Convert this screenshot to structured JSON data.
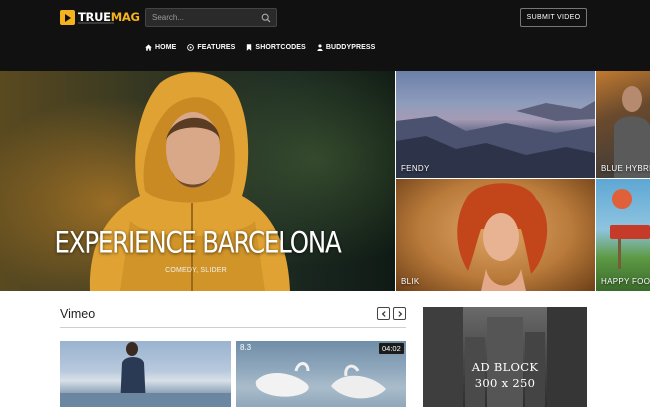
{
  "header": {
    "logo": {
      "brand_main": "TRUE",
      "brand_accent": "MAG"
    },
    "search": {
      "placeholder": "Search..."
    },
    "submit_label": "SUBMIT VIDEO",
    "nav": [
      {
        "label": "HOME",
        "icon": "home-icon"
      },
      {
        "label": "FEATURES",
        "icon": "circle-play-icon"
      },
      {
        "label": "SHORTCODES",
        "icon": "bookmark-icon"
      },
      {
        "label": "BUDDYPRESS",
        "icon": "user-icon"
      }
    ]
  },
  "hero": {
    "title": "EXPERIENCE BARCELONA",
    "categories": "COMEDY, SLIDER"
  },
  "tiles": [
    {
      "label": "FENDY"
    },
    {
      "label": "BLIK"
    },
    {
      "label": "BLUE HYBRID"
    },
    {
      "label": "HAPPY FOOD"
    }
  ],
  "section": {
    "title": "Vimeo",
    "videos": [
      {
        "rating": "",
        "duration": ""
      },
      {
        "rating": "8.3",
        "duration": "04:02"
      }
    ]
  },
  "ad": {
    "line1": "AD BLOCK",
    "line2": "300 x 250"
  },
  "colors": {
    "accent": "#f5b21f",
    "header_bg": "#111111"
  }
}
